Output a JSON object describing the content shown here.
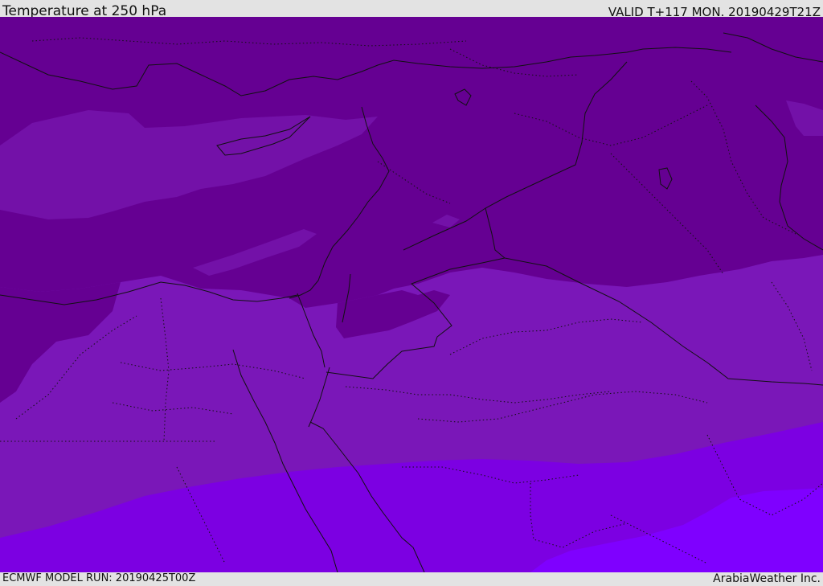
{
  "header": {
    "title": "Temperature at 250 hPa",
    "valid_time": "VALID T+117 MON. 20190429T21Z"
  },
  "footer": {
    "model_run": "ECMWF MODEL RUN: 20190425T00Z",
    "credit": "ArabiaWeather Inc."
  },
  "colors": {
    "background": "#e3e3e3",
    "band_coldest": "#650092",
    "band_cold": "#7311a8",
    "band_mid": "#7a17b8",
    "band_warm": "#7c00e2",
    "band_warmest": "#7f00ff",
    "coastline": "#111111",
    "borders": "#111111"
  }
}
